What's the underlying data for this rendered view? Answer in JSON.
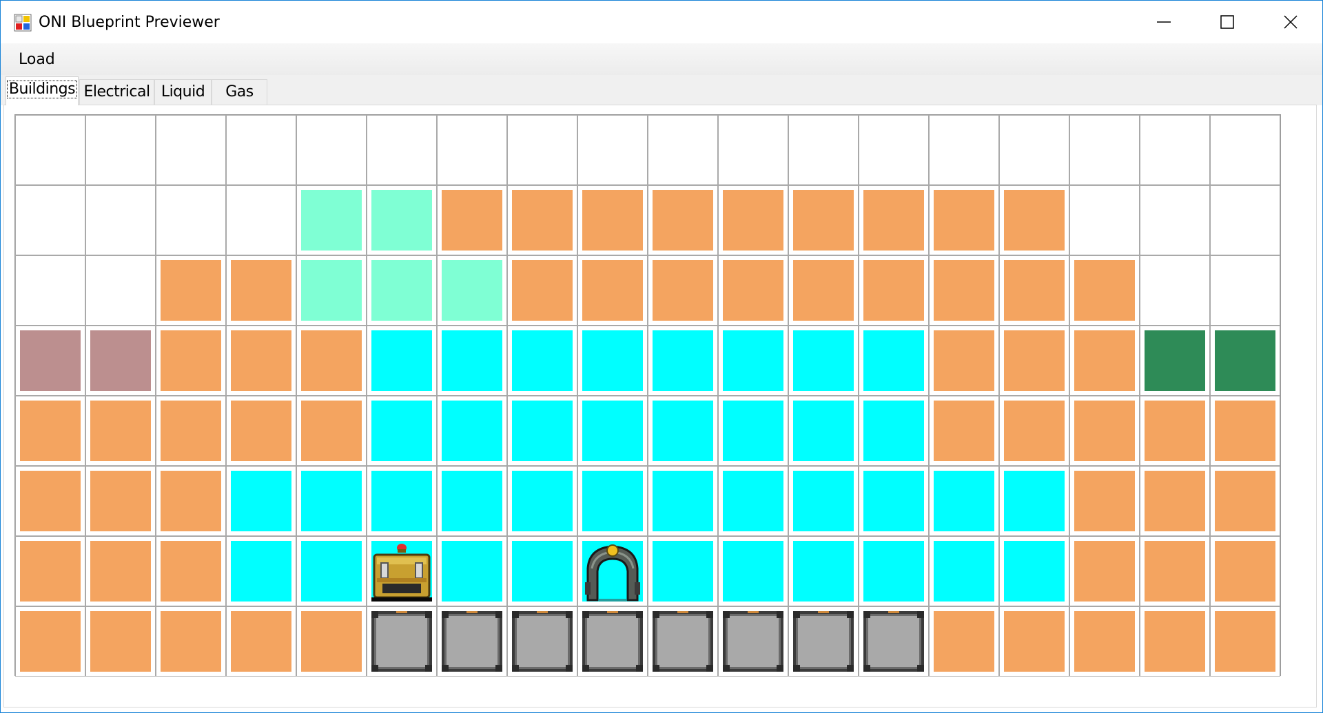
{
  "window": {
    "title": "ONI Blueprint Previewer",
    "controls": {
      "minimize_icon": "minimize-icon",
      "maximize_icon": "maximize-icon",
      "close_icon": "close-icon"
    }
  },
  "menu": {
    "items": [
      {
        "label": "Load"
      }
    ]
  },
  "tabs": [
    {
      "label": "Buildings",
      "selected": true
    },
    {
      "label": "Electrical",
      "selected": false
    },
    {
      "label": "Liquid",
      "selected": false
    },
    {
      "label": "Gas",
      "selected": false
    }
  ],
  "blueprint": {
    "columns": 18,
    "rows": 8,
    "legend": {
      ".": {
        "kind": "empty",
        "color": null
      },
      "O": {
        "kind": "orange-tile",
        "color": "#f4a460"
      },
      "M": {
        "kind": "mint-tile",
        "color": "#7fffd4"
      },
      "C": {
        "kind": "cyan-tile",
        "color": "#00ffff"
      },
      "R": {
        "kind": "rose-tile",
        "color": "#bc8f8f"
      },
      "G": {
        "kind": "green-tile",
        "color": "#2e8b57"
      },
      "S": {
        "kind": "metal-tile",
        "color": "#a9a9a9"
      },
      "B": {
        "kind": "storage-bin",
        "color": "#00ffff"
      },
      "P": {
        "kind": "printing-pod",
        "color": "#00ffff"
      }
    },
    "grid": [
      "..................",
      "....MMOOOOOOOOO...",
      "..OOMMMOOOOOOOOO..",
      "RROOOCCCCCCCCOOOGG",
      "OOOOOCCCCCCCCOOOOO",
      "OOOCCCCCCCCCCCCOOO",
      "OOOCCBCCPCCCCCCOOO",
      "OOOOOSSSSSSSSOOOOO"
    ]
  }
}
